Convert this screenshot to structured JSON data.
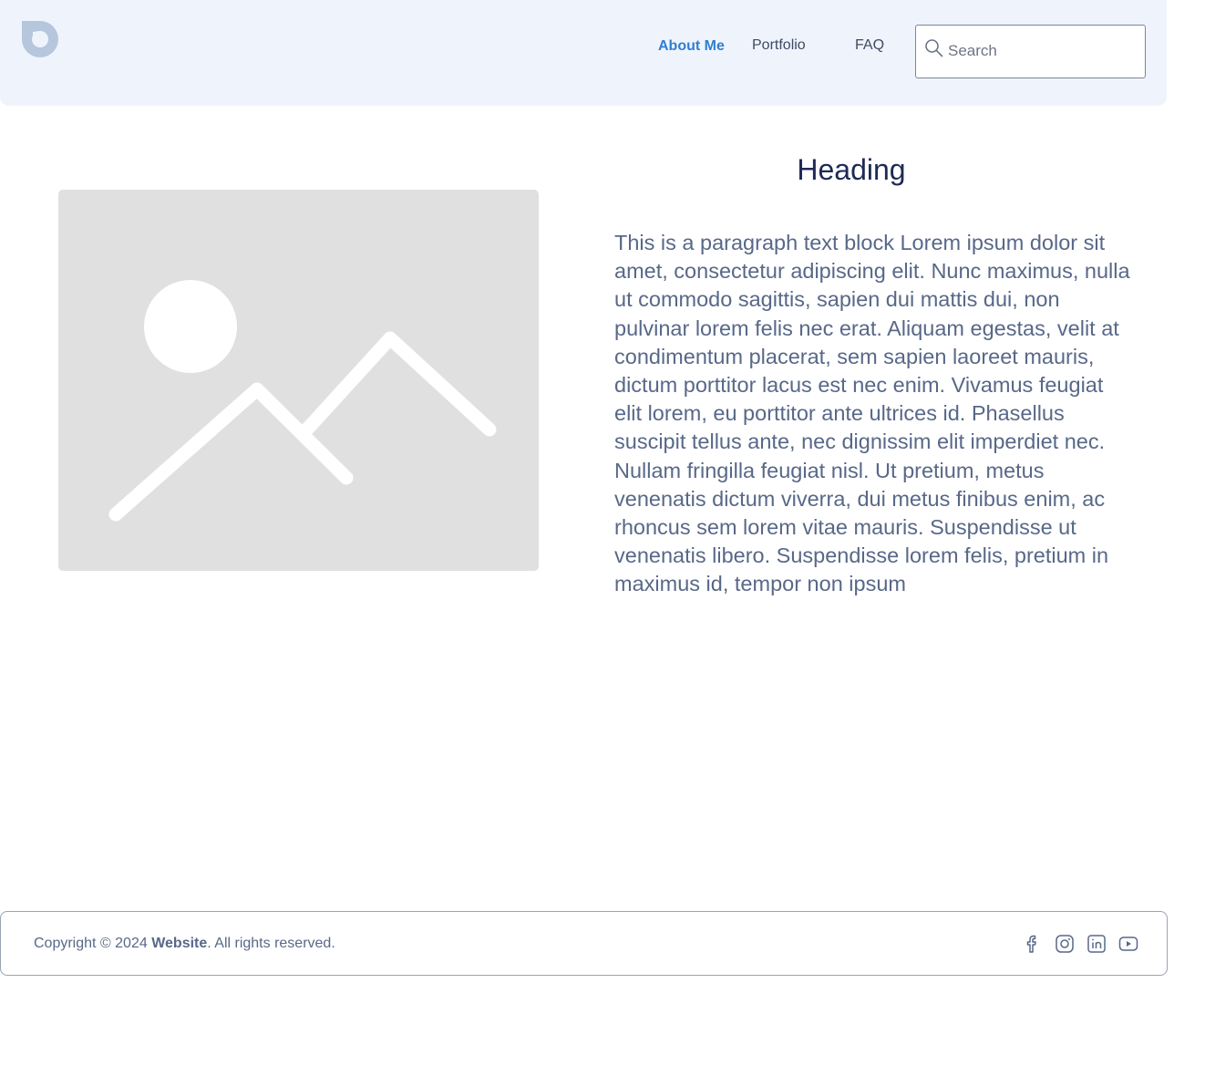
{
  "header": {
    "logo_icon": "droplet-ring-logo-icon",
    "nav": {
      "about": "About Me",
      "portfolio": "Portfolio",
      "faq": "FAQ"
    },
    "search": {
      "icon": "search-icon",
      "placeholder": "Search",
      "value": ""
    }
  },
  "main": {
    "image_icon": "image-placeholder-icon",
    "heading": "Heading",
    "paragraph": "This is a paragraph text block Lorem ipsum dolor sit amet, consectetur adipiscing elit. Nunc maximus, nulla ut commodo sagittis, sapien dui mattis dui, non pulvinar lorem felis nec erat. Aliquam egestas, velit at condimentum placerat, sem sapien laoreet mauris, dictum porttitor lacus est nec enim. Vivamus feugiat elit lorem, eu porttitor ante ultrices id. Phasellus suscipit tellus ante, nec dignissim elit imperdiet nec. Nullam fringilla feugiat nisl. Ut pretium, metus venenatis dictum viverra, dui metus finibus enim, ac rhoncus sem lorem vitae mauris. Suspendisse ut venenatis libero. Suspendisse lorem felis, pretium in maximus id, tempor non ipsum"
  },
  "footer": {
    "copyright_prefix": "Copyright © 2024 ",
    "copyright_brand": "Website",
    "copyright_suffix": ". All rights reserved.",
    "social": [
      "facebook-icon",
      "instagram-icon",
      "linkedin-icon",
      "youtube-icon"
    ]
  },
  "colors": {
    "header_bg": "#eff4fc",
    "nav_active": "#2f7fd0",
    "nav_text": "#3d4a63",
    "heading": "#1e2a54",
    "body_text": "#586888",
    "placeholder_bg": "#e0e0e0",
    "logo": "#b6c6dc"
  }
}
